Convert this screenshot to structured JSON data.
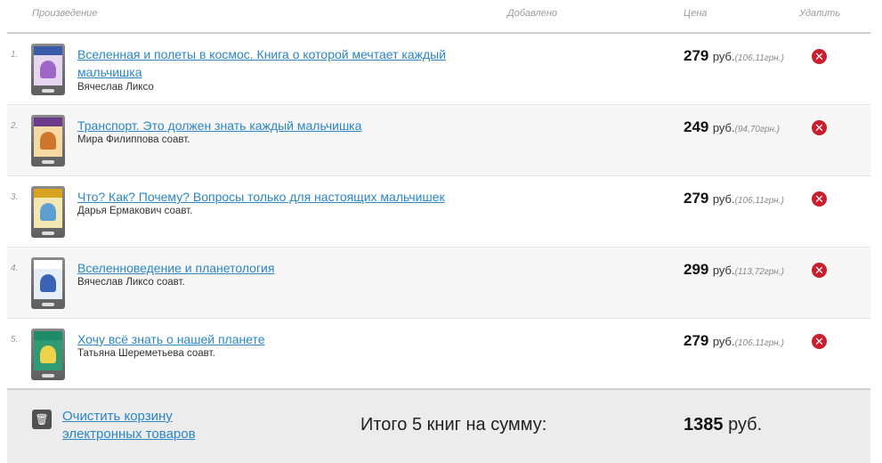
{
  "columns": {
    "work": "Произведение",
    "added": "Добавлено",
    "price": "Цена",
    "delete": "Удалить"
  },
  "items": [
    {
      "num": "1.",
      "title": "Вселенная и полеты в космос. Книга о которой мечтает каждый мальчишка",
      "author": "Вячеслав Ликсо",
      "coauthor": "",
      "price": "279",
      "currency": "руб.",
      "price_uah": "(106,11грн.)",
      "cover_band": "#3b5aa8",
      "cover_bg": "#e7d6f0",
      "cover_fig": "#9d66c7"
    },
    {
      "num": "2.",
      "title": "Транспорт. Это должен знать каждый мальчишка",
      "author": "Мира Филиппова",
      "coauthor": "соавт.",
      "price": "249",
      "currency": "руб.",
      "price_uah": "(94,70грн.)",
      "cover_band": "#6a3b88",
      "cover_bg": "#f4d9a2",
      "cover_fig": "#d0762c"
    },
    {
      "num": "3.",
      "title": "Что? Как? Почему? Вопросы только для настоящих мальчишек",
      "author": "Дарья Ермакович",
      "coauthor": "соавт.",
      "price": "279",
      "currency": "руб.",
      "price_uah": "(106,11грн.)",
      "cover_band": "#d8a21f",
      "cover_bg": "#f3e8b3",
      "cover_fig": "#5e9fd2"
    },
    {
      "num": "4.",
      "title": "Вселенноведение и планетология",
      "author": "Вячеслав Ликсо",
      "coauthor": "соавт.",
      "price": "299",
      "currency": "руб.",
      "price_uah": "(113,72грн.)",
      "cover_band": "#ffffff",
      "cover_bg": "#e8eef8",
      "cover_fig": "#3a62b5"
    },
    {
      "num": "5.",
      "title": "Хочу всё знать о нашей планете",
      "author": "Татьяна Шереметьева",
      "coauthor": "соавт.",
      "price": "279",
      "currency": "руб.",
      "price_uah": "(106,11грн.)",
      "cover_band": "#1f8a6a",
      "cover_bg": "#2e9b74",
      "cover_fig": "#f0d24a"
    }
  ],
  "footer": {
    "clear_link": "Очистить корзину электронных товаров",
    "total_label": "Итого 5 книг на сумму:",
    "total_value": "1385",
    "total_currency": "руб."
  },
  "delete_glyph": "✕"
}
